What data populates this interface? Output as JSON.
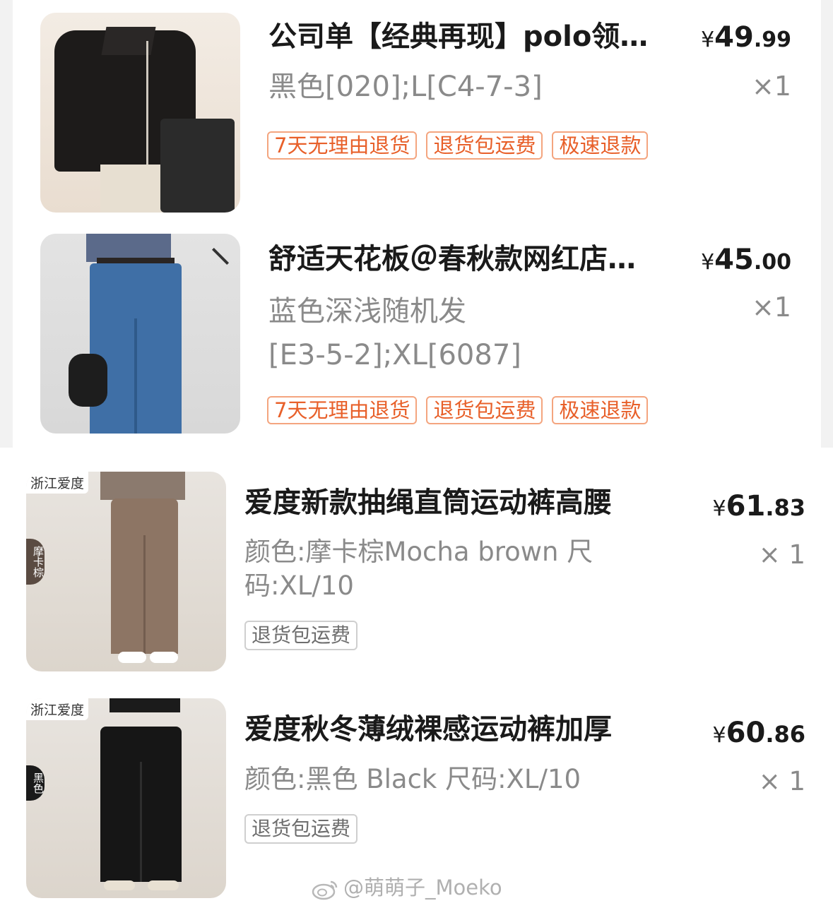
{
  "items": [
    {
      "title": "公司单【经典再现】polo领…",
      "price_int": "49",
      "price_dec": ".99",
      "currency": "¥",
      "qty": "×1",
      "spec_lines": [
        "黑色[020];L[C4-7-3]"
      ],
      "tags": [
        "7天无理由退货",
        "退货包运费",
        "极速退款"
      ]
    },
    {
      "title": "舒适天花板＠春秋款网红店…",
      "price_int": "45",
      "price_dec": ".00",
      "currency": "¥",
      "qty": "×1",
      "spec_lines": [
        "蓝色深浅随机发",
        "[E3-5-2];XL[6087]"
      ],
      "tags": [
        "7天无理由退货",
        "退货包运费",
        "极速退款"
      ]
    },
    {
      "title": "爱度新款抽绳直筒运动裤高腰",
      "price_int": "61",
      "price_dec": ".83",
      "currency": "¥",
      "qty": "× 1",
      "spec_lines": [
        "颜色:摩卡棕Mocha brown 尺",
        "码:XL/10"
      ],
      "tag": "退货包运费",
      "store_badge": "浙江爱度",
      "side_tab": "摩卡棕"
    },
    {
      "title": "爱度秋冬薄绒裸感运动裤加厚",
      "price_int": "60",
      "price_dec": ".86",
      "currency": "¥",
      "qty": "× 1",
      "spec_lines": [
        "颜色:黑色 Black 尺码:XL/10"
      ],
      "tag": "退货包运费",
      "store_badge": "浙江爱度",
      "side_tab": "黑色"
    }
  ],
  "watermark": "@萌萌子_Moeko",
  "icons": [
    "weibo-icon"
  ],
  "colors": {
    "tag_orange": "#e8602a",
    "tag_border_orange": "#f4a57f",
    "spec_gray": "#8a8a8a",
    "text_dark": "#1a1a1a"
  }
}
